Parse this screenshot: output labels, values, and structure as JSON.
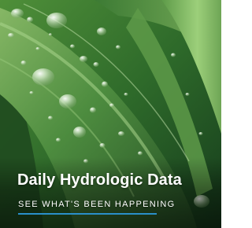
{
  "card": {
    "title": "Daily Hydrologic Data",
    "subtitle": "SEE WHAT'S BEEN HAPPENING",
    "image": "leaf-with-water-drops-photo",
    "accent_color": "#2a8fc9"
  }
}
